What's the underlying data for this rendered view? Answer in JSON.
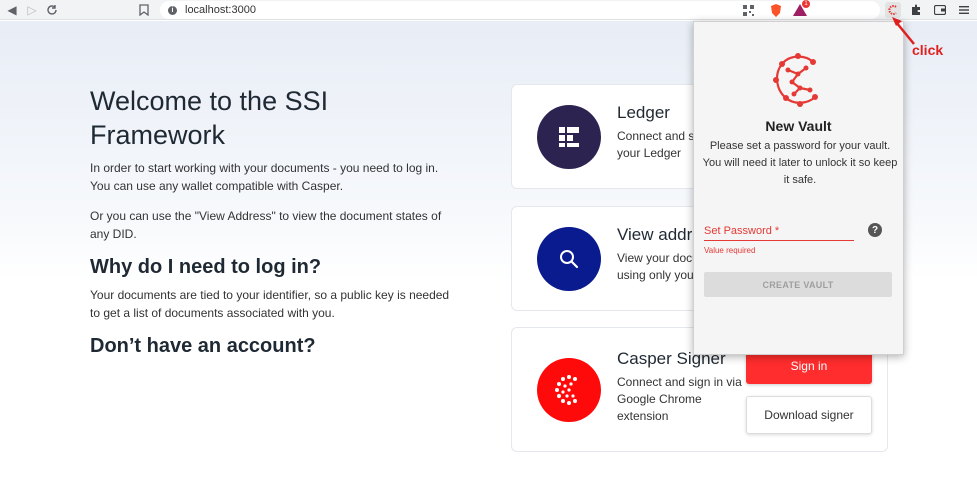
{
  "browser": {
    "url": "localhost:3000",
    "notification_badge": "1"
  },
  "page": {
    "title": "Welcome to the SSI Framework",
    "intro": "In order to start working with your documents - you need to log in. You can use any wallet compatible with Casper.",
    "view_address_note": "Or you can use the \"View Address\" to view the document states of any DID.",
    "why_heading": "Why do I need to log in?",
    "why_text": "Your documents are tied to your identifier, so a public key is needed to get a list of documents associated with you.",
    "no_account_heading": "Don’t have an account?"
  },
  "cards": {
    "ledger": {
      "title": "Ledger",
      "desc": "Connect and sign with your Ledger"
    },
    "view_address": {
      "title": "View address",
      "desc": "View your documents using only your"
    },
    "casper_signer": {
      "title": "Casper Signer",
      "desc": "Connect and sign in via Google Chrome extension",
      "sign_in_label": "Sign in",
      "download_label": "Download signer"
    }
  },
  "popup": {
    "title": "New Vault",
    "description": "Please set a password for your vault. You will need it later to unlock it so keep it safe.",
    "password_label": "Set Password *",
    "help_glyph": "?",
    "error_text": "Value required",
    "create_label": "CREATE VAULT"
  },
  "annotation": {
    "label": "click"
  },
  "colors": {
    "casper_red": "#ff2d2d",
    "ledger_dark": "#2c2350",
    "view_blue": "#0a1b8f",
    "error_red": "#e53935"
  }
}
